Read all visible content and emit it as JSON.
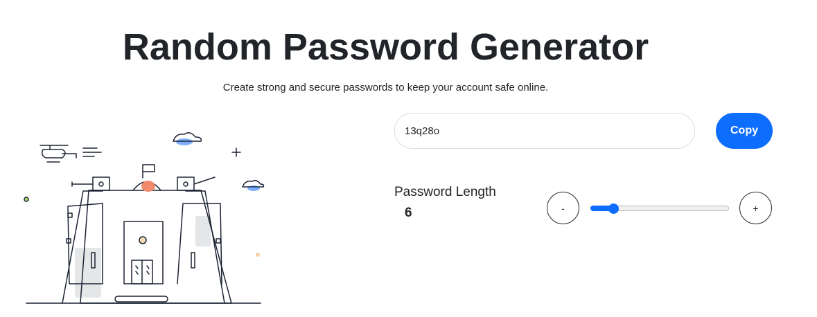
{
  "header": {
    "title": "Random Password Generator",
    "subtitle": "Create strong and secure passwords to keep your account safe online."
  },
  "generator": {
    "password_value": "13q28o",
    "copy_label": "Copy",
    "length_label": "Password Length",
    "length_value": "6",
    "decrement_label": "-",
    "increment_label": "+",
    "slider_fraction": 0.13
  },
  "colors": {
    "accent": "#0d6efd",
    "text": "#212529"
  },
  "icons": {
    "illustration": "castle-illustration"
  }
}
